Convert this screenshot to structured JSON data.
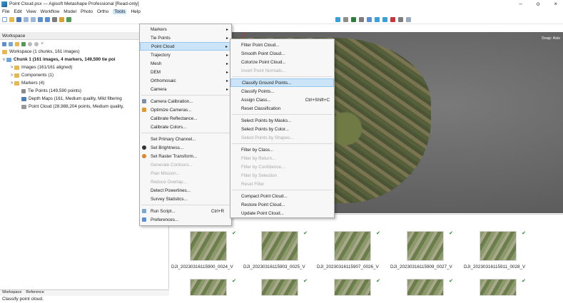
{
  "window": {
    "title": "Point Cloud.psx — Agisoft Metashape Professional [Read-only]",
    "controls": [
      "–",
      "o",
      "×"
    ]
  },
  "menubar": [
    "File",
    "Edit",
    "View",
    "Workflow",
    "Model",
    "Photo",
    "Ortho",
    "Tools",
    "Help"
  ],
  "workspace": {
    "header": "Workspace",
    "tree": [
      {
        "label": "Workspace (1 chunks, 161 images)",
        "expander": ""
      },
      {
        "label": "Chunk 1 (161 images, 4 markers, 149,590 tie poi",
        "expander": "v"
      },
      {
        "label": "Images (161/161 aligned)",
        "expander": ">"
      },
      {
        "label": "Components (1)",
        "expander": ">"
      },
      {
        "label": "Markers (4)",
        "expander": ">"
      },
      {
        "label": "Tie Points (149,590 points)",
        "expander": ""
      },
      {
        "label": "Depth Maps (161, Medium quality, Mild filtering",
        "expander": ""
      },
      {
        "label": "Point Cloud (28,988,204 points, Medium quality,",
        "expander": ""
      }
    ],
    "bottom_tabs": [
      "Workspace",
      "Reference"
    ]
  },
  "status": "Classify point cloud.",
  "model_view": {
    "snap_label": "Snap: Axis"
  },
  "tools_menu": {
    "items": [
      {
        "label": "Markers",
        "submenu": true
      },
      {
        "label": "Tie Points",
        "submenu": true
      },
      {
        "label": "Point Cloud",
        "submenu": true,
        "highlighted": true
      },
      {
        "label": "Trajectory",
        "submenu": true
      },
      {
        "label": "Mesh",
        "submenu": true
      },
      {
        "label": "DEM",
        "submenu": true
      },
      {
        "label": "Orthomosaic",
        "submenu": true
      },
      {
        "label": "Camera",
        "submenu": true
      },
      {
        "label": "Camera Calibration..."
      },
      {
        "label": "Optimize Cameras..."
      },
      {
        "label": "Calibrate Reflectance..."
      },
      {
        "label": "Calibrate Colors..."
      },
      {
        "label": "Set Primary Channel..."
      },
      {
        "label": "Set Brightness..."
      },
      {
        "label": "Set Raster Transform..."
      },
      {
        "label": "Generate Contours...",
        "disabled": true
      },
      {
        "label": "Plan Mission...",
        "disabled": true
      },
      {
        "label": "Reduce Overlap...",
        "disabled": true
      },
      {
        "label": "Detect Powerlines..."
      },
      {
        "label": "Survey Statistics..."
      },
      {
        "label": "Run Script...",
        "shortcut": "Ctrl+R"
      },
      {
        "label": "Preferences..."
      }
    ]
  },
  "point_cloud_menu": {
    "items": [
      {
        "label": "Filter Point Cloud..."
      },
      {
        "label": "Smooth Point Cloud..."
      },
      {
        "label": "Colorize Point Cloud..."
      },
      {
        "label": "Invert Point Normals...",
        "disabled": true
      },
      {
        "label": "Classify Ground Points...",
        "highlighted": true
      },
      {
        "label": "Classify Points..."
      },
      {
        "label": "Assign Class...",
        "shortcut": "Ctrl+Shift+C"
      },
      {
        "label": "Reset Classification"
      },
      {
        "label": "Select Points by Masks..."
      },
      {
        "label": "Select Points by Color..."
      },
      {
        "label": "Select Points by Shapes...",
        "disabled": true
      },
      {
        "label": "Filter by Class..."
      },
      {
        "label": "Filter by Return...",
        "disabled": true
      },
      {
        "label": "Filter by Confidence...",
        "disabled": true
      },
      {
        "label": "Filter by Selection",
        "disabled": true
      },
      {
        "label": "Reset Filter",
        "disabled": true
      },
      {
        "label": "Compact Point Cloud..."
      },
      {
        "label": "Restore Point Cloud..."
      },
      {
        "label": "Update Point Cloud..."
      }
    ]
  },
  "photos": [
    "DJI_20230316115900_0024_V",
    "DJI_20230316115903_0025_V",
    "DJI_20230316115907_0026_V",
    "DJI_20230316115909_0027_V",
    "DJI_20230316115911_0028_V"
  ],
  "photo_badge": "✔"
}
